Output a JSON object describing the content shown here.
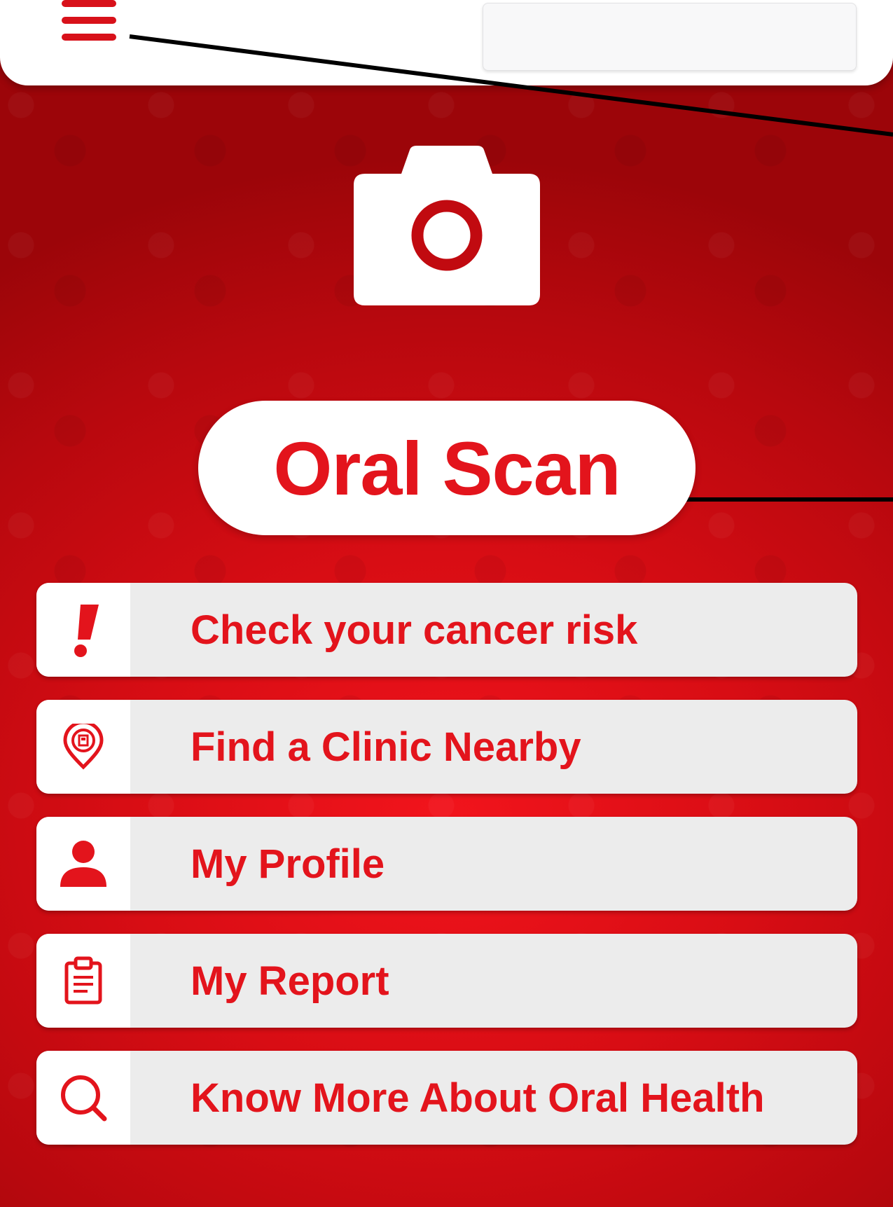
{
  "header": {
    "menu_icon": "hamburger-menu-icon",
    "search": {
      "placeholder": "",
      "value": ""
    }
  },
  "camera": {
    "icon": "camera-icon"
  },
  "primary_action": {
    "label": "Oral Scan"
  },
  "menu": {
    "items": [
      {
        "label": "Check your cancer risk",
        "icon": "exclamation-icon"
      },
      {
        "label": "Find a Clinic Nearby",
        "icon": "clinic-location-pin-icon"
      },
      {
        "label": "My Profile",
        "icon": "user-icon"
      },
      {
        "label": "My Report",
        "icon": "clipboard-report-icon"
      },
      {
        "label": "Know More About Oral Health",
        "icon": "search-icon"
      }
    ]
  },
  "colors": {
    "accent": "#e3141c",
    "background_dark": "#b8080e",
    "card": "#ececec",
    "white": "#ffffff"
  }
}
